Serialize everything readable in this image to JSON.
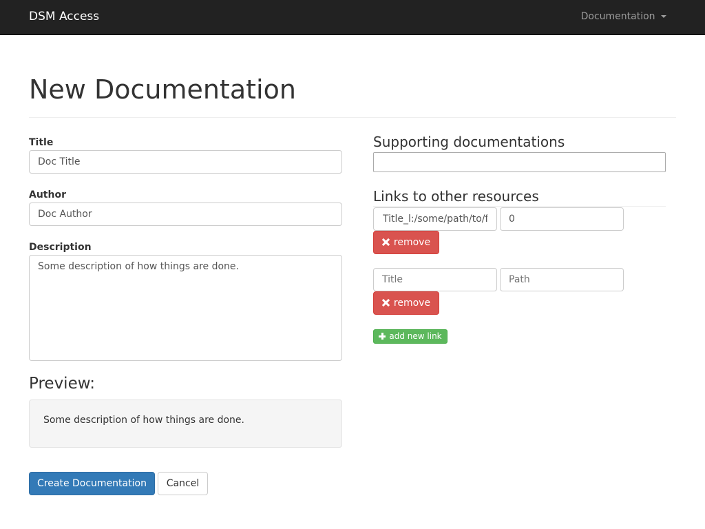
{
  "navbar": {
    "brand": "DSM Access",
    "menu_label": "Documentation"
  },
  "page": {
    "title": "New Documentation"
  },
  "form": {
    "title_label": "Title",
    "title_value": "Doc Title",
    "author_label": "Author",
    "author_value": "Doc Author",
    "description_label": "Description",
    "description_value": "Some description of how things are done."
  },
  "preview": {
    "heading": "Preview:",
    "text": "Some description of how things are done."
  },
  "actions": {
    "create_label": "Create Documentation",
    "cancel_label": "Cancel"
  },
  "supporting": {
    "heading": "Supporting documentations",
    "value": ""
  },
  "links": {
    "heading": "Links to other resources",
    "items": [
      {
        "title_value": "Title_l:/some/path/to/f",
        "path_value": "0",
        "remove_label": "remove"
      },
      {
        "title_placeholder": "Title",
        "path_placeholder": "Path",
        "remove_label": "remove"
      }
    ],
    "add_label": "add new link"
  },
  "colors": {
    "navbar_bg": "#222222",
    "primary": "#337ab7",
    "danger": "#d9534f",
    "success": "#5cb85c",
    "preview_bg": "#f5f5f5"
  }
}
